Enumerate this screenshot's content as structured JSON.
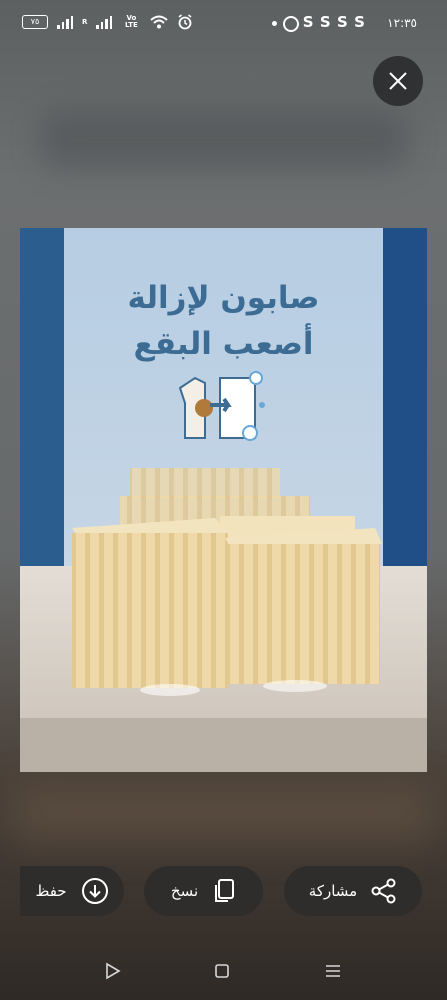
{
  "status_bar": {
    "time": "١٢:٣٥",
    "notification_letters": "SSSS",
    "battery": "٧٥",
    "carrier_r": "R",
    "volte": "Vo LTE"
  },
  "image": {
    "headline_line1": "صابون لإزالة",
    "headline_line2": "أصعب البقع"
  },
  "actions": {
    "share_label": "مشاركة",
    "copy_label": "نسخ",
    "save_label": "حفظ"
  },
  "colors": {
    "headline": "#3c6c94",
    "button_bg": "#2f2d2c"
  }
}
